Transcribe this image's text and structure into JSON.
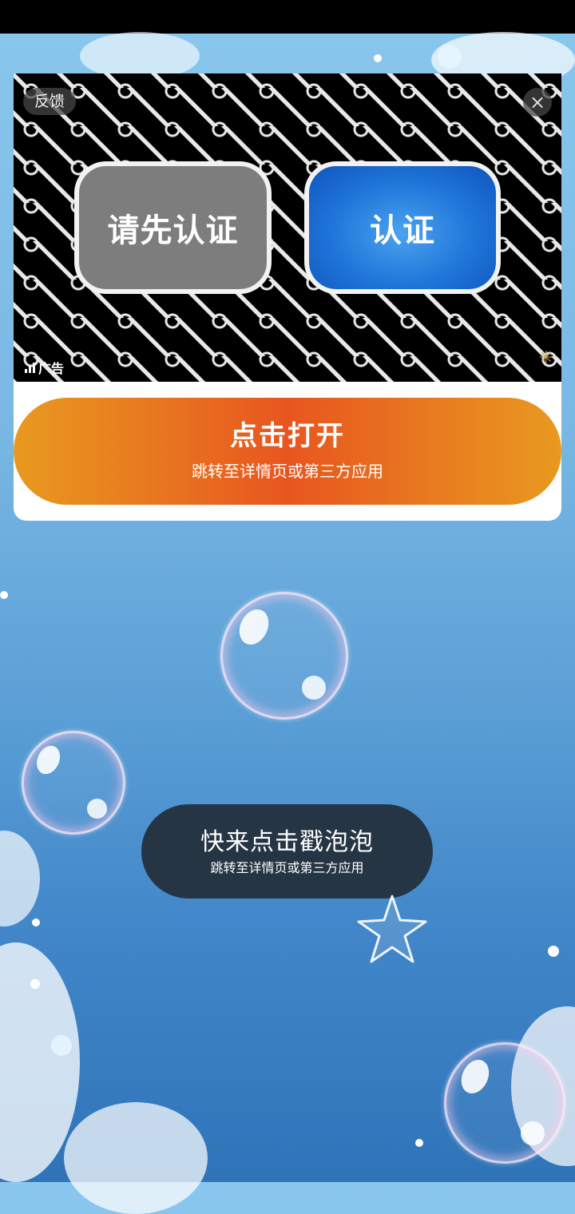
{
  "ad": {
    "feedback_label": "反馈",
    "close_icon": "×",
    "button_left_label": "请先认证",
    "button_right_label": "认证",
    "ad_label": "广告",
    "cta_title": "点击打开",
    "cta_subtitle": "跳转至详情页或第三方应用"
  },
  "toast": {
    "title": "快来点击戳泡泡",
    "subtitle": "跳转至详情页或第三方应用"
  },
  "colors": {
    "cta_gradient": [
      "#e89a1f",
      "#e8561f"
    ],
    "toast_bg": "#263544",
    "verify_blue": "#1f74d8",
    "verify_gray": "#7d7d7d"
  }
}
